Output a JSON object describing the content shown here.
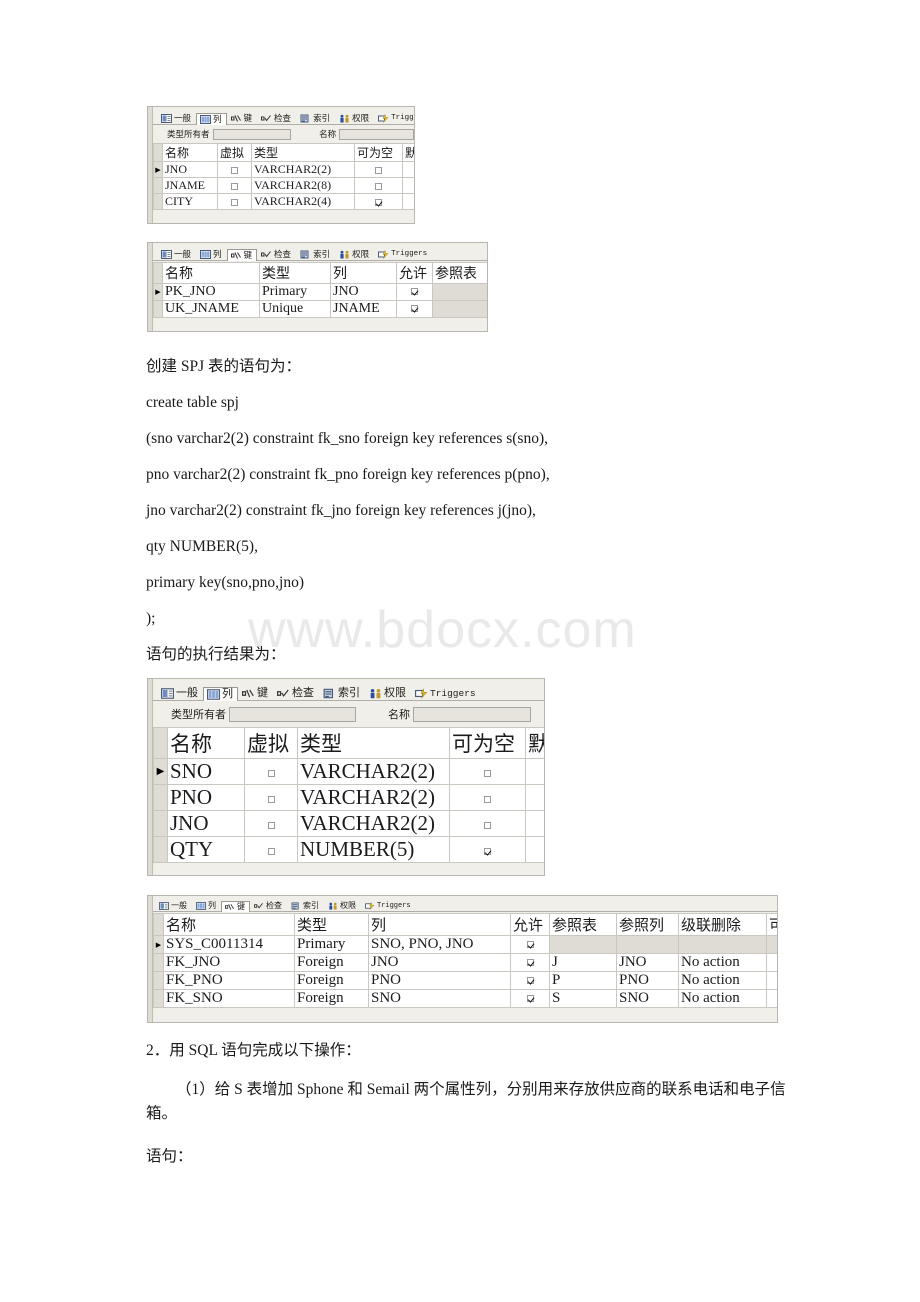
{
  "watermark": "www.bdocx.com",
  "tabs": {
    "general": "一般",
    "columns": "列",
    "keys": "键",
    "check": "检查",
    "indexes": "索引",
    "privileges": "权限",
    "triggers": "Triggers"
  },
  "filter": {
    "owner_label": "类型所有者",
    "name_label": "名称",
    "owner_value": "",
    "name_value": ""
  },
  "column_headers": {
    "name": "名称",
    "virtual": "虚拟",
    "type": "类型",
    "nullable": "可为空",
    "default": "默认"
  },
  "key_headers": {
    "name": "名称",
    "type": "类型",
    "column": "列",
    "enabled": "允许",
    "ref_table": "参照表",
    "ref_column": "参照列",
    "cascade_delete": "级联删除",
    "trailing": "可"
  },
  "screenshot_j_columns": {
    "rows": [
      {
        "marker": "▶",
        "name": "JNO",
        "virtual": false,
        "type": "VARCHAR2(2)",
        "nullable": false
      },
      {
        "marker": "",
        "name": "JNAME",
        "virtual": false,
        "type": "VARCHAR2(8)",
        "nullable": false
      },
      {
        "marker": "",
        "name": "CITY",
        "virtual": false,
        "type": "VARCHAR2(4)",
        "nullable": true
      }
    ]
  },
  "screenshot_j_keys": {
    "rows": [
      {
        "marker": "▶",
        "name": "PK_JNO",
        "type": "Primary",
        "column": "JNO",
        "enabled": true
      },
      {
        "marker": "",
        "name": "UK_JNAME",
        "type": "Unique",
        "column": "JNAME",
        "enabled": true
      }
    ]
  },
  "screenshot_spj_columns": {
    "rows": [
      {
        "marker": "▶",
        "name": "SNO",
        "virtual": false,
        "type": "VARCHAR2(2)",
        "nullable": false
      },
      {
        "marker": "",
        "name": "PNO",
        "virtual": false,
        "type": "VARCHAR2(2)",
        "nullable": false
      },
      {
        "marker": "",
        "name": "JNO",
        "virtual": false,
        "type": "VARCHAR2(2)",
        "nullable": false
      },
      {
        "marker": "",
        "name": "QTY",
        "virtual": false,
        "type": "NUMBER(5)",
        "nullable": true
      }
    ]
  },
  "screenshot_spj_keys": {
    "rows": [
      {
        "marker": "▶",
        "name": "SYS_C0011314",
        "type": "Primary",
        "column": "SNO, PNO, JNO",
        "enabled": true,
        "ref_table": "",
        "ref_column": "",
        "cascade_delete": ""
      },
      {
        "marker": "",
        "name": "FK_JNO",
        "type": "Foreign",
        "column": "JNO",
        "enabled": true,
        "ref_table": "J",
        "ref_column": "JNO",
        "cascade_delete": "No action"
      },
      {
        "marker": "",
        "name": "FK_PNO",
        "type": "Foreign",
        "column": "PNO",
        "enabled": true,
        "ref_table": "P",
        "ref_column": "PNO",
        "cascade_delete": "No action"
      },
      {
        "marker": "",
        "name": "FK_SNO",
        "type": "Foreign",
        "column": "SNO",
        "enabled": true,
        "ref_table": "S",
        "ref_column": "SNO",
        "cascade_delete": "No action"
      }
    ]
  },
  "body": {
    "heading_create_spj": "创建 SPJ 表的语句为：",
    "sql_line1": "create table spj",
    "sql_line2": "(sno varchar2(2) constraint fk_sno foreign key references s(sno),",
    "sql_line3": "pno varchar2(2) constraint fk_pno foreign key references p(pno),",
    "sql_line4": "jno varchar2(2) constraint fk_jno foreign key references j(jno),",
    "sql_line5": " qty NUMBER(5),",
    "sql_line6": " primary key(sno,pno,jno)",
    "sql_line7": ");",
    "result_label": "语句的执行结果为：",
    "item2": "2．用 SQL 语句完成以下操作：",
    "item2_1": "（1）给 S 表增加 Sphone 和 Semail 两个属性列，分别用来存放供应商的联系电话和电子信箱。",
    "statement_label": "语句："
  }
}
